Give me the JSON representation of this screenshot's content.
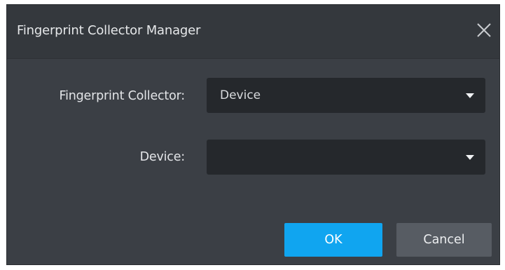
{
  "dialog": {
    "title": "Fingerprint Collector Manager",
    "close_icon": "close-icon"
  },
  "form": {
    "collector_label": "Fingerprint Collector:",
    "collector_value": "Device",
    "device_label": "Device:",
    "device_value": ""
  },
  "buttons": {
    "ok_label": "OK",
    "cancel_label": "Cancel"
  },
  "colors": {
    "dialog_bg": "#3b3f45",
    "titlebar_bg": "#34383d",
    "select_bg": "#25282c",
    "primary": "#10a5f0",
    "secondary": "#575c63"
  }
}
